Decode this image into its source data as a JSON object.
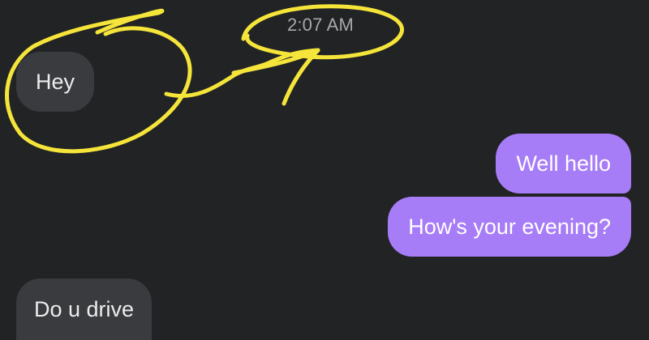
{
  "conversation": {
    "timestamp": "2:07 AM",
    "messages": [
      {
        "sender": "other",
        "text": "Hey"
      },
      {
        "sender": "me",
        "text": "Well hello"
      },
      {
        "sender": "me",
        "text": "How's your evening?"
      },
      {
        "sender": "other",
        "text": "Do u drive"
      }
    ]
  },
  "colors": {
    "background": "#222325",
    "incoming_bubble": "#3a3b3e",
    "outgoing_bubble": "#a77cf7",
    "annotation": "#f5e53a",
    "timestamp_text": "#a8a8aa"
  },
  "annotation": {
    "description_shapes": [
      "circle-around-hey",
      "circle-around-timestamp",
      "arrow-connecting"
    ]
  }
}
